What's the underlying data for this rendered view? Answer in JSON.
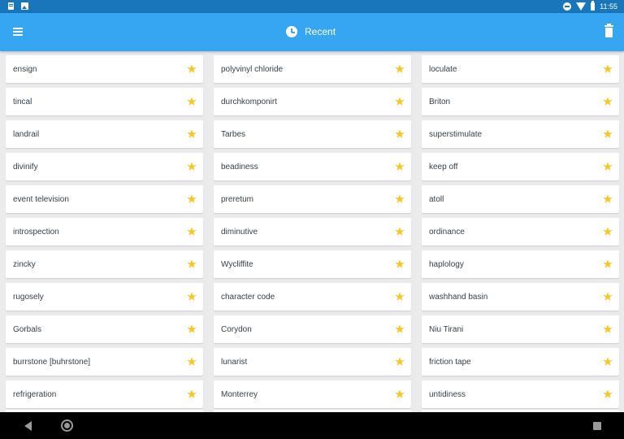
{
  "status_bar": {
    "time": "11:55",
    "left_icons": [
      "notes-icon",
      "image-icon"
    ],
    "right_icons": [
      "do-not-disturb-icon",
      "wifi-icon",
      "battery-icon"
    ]
  },
  "app_bar": {
    "title": "Recent",
    "title_icon": "clock-icon",
    "menu_icon": "menu-icon",
    "action_icon": "trash-icon",
    "color": "#36a6f2"
  },
  "words": [
    "ensign",
    "polyvinyl chloride",
    "loculate",
    "tincal",
    "durchkomponirt",
    "Briton",
    "landrail",
    "Tarbes",
    "superstimulate",
    "divinify",
    "beadiness",
    "keep off",
    "event television",
    "preretum",
    "atoll",
    "introspection",
    "diminutive",
    "ordinance",
    "zincky",
    "Wycliffite",
    "haplology",
    "rugosely",
    "character code",
    "washhand basin",
    "Gorbals",
    "Corydon",
    "Niu Tirani",
    "burrstone [buhrstone]",
    "lunarist",
    "friction tape",
    "refrigeration",
    "Monterrey",
    "untidiness"
  ],
  "star_color": "#fcc421",
  "nav_bar": {
    "buttons": [
      "back-icon",
      "home-icon",
      "recents-icon"
    ]
  }
}
